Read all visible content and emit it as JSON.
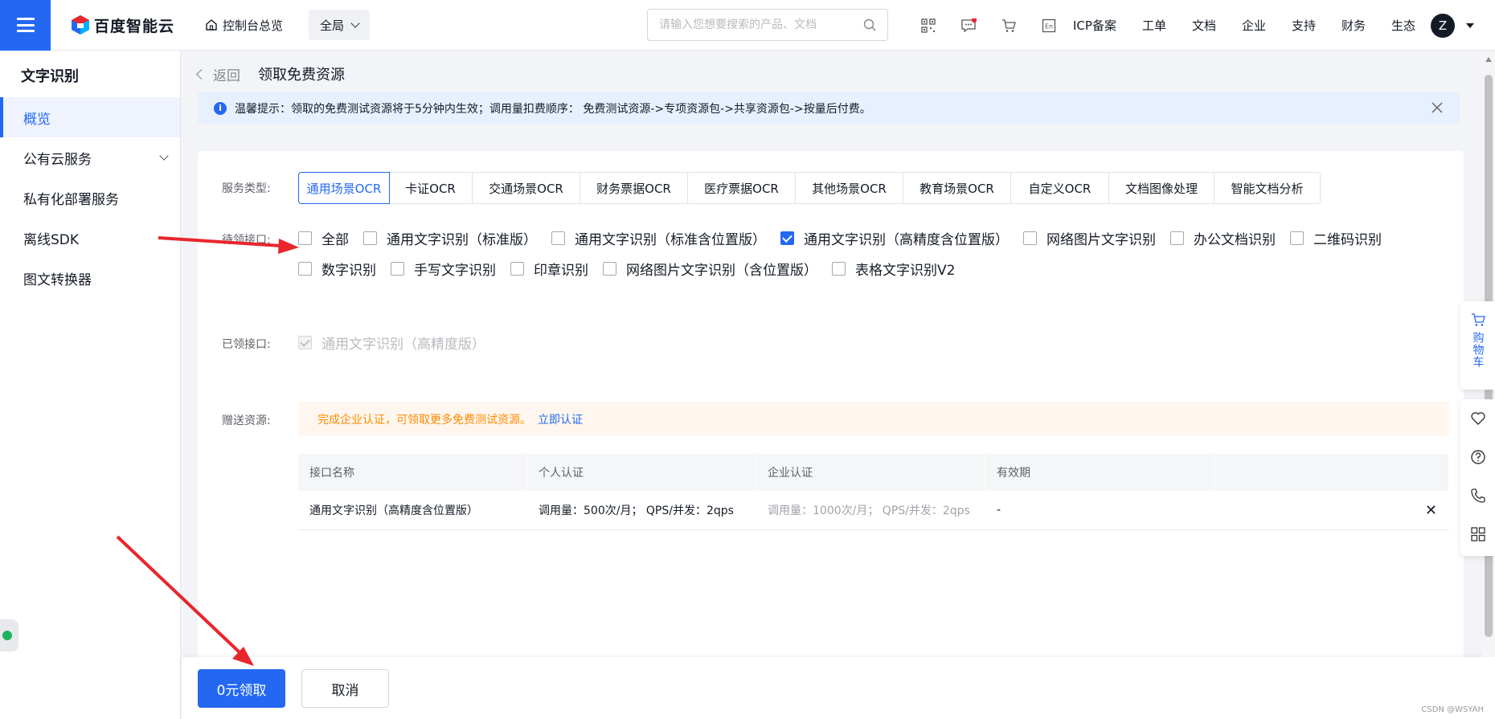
{
  "header": {
    "brand": "百度智能云",
    "home_label": "控制台总览",
    "region": "全局",
    "search_placeholder": "请输入您想要搜索的产品、文档",
    "links": [
      "ICP备案",
      "工单",
      "文档",
      "企业",
      "支持",
      "财务",
      "生态"
    ],
    "avatar_letter": "Z",
    "icons": [
      "qrcode-icon",
      "message-icon",
      "cart-icon",
      "language-icon"
    ]
  },
  "sidebar": {
    "title": "文字识别",
    "items": [
      {
        "label": "概览",
        "active": true
      },
      {
        "label": "公有云服务",
        "expandable": true
      },
      {
        "label": "私有化部署服务"
      },
      {
        "label": "离线SDK"
      },
      {
        "label": "图文转换器"
      }
    ]
  },
  "page": {
    "back_label": "返回",
    "title": "领取免费资源",
    "notice": "温馨提示：领取的免费测试资源将于5分钟内生效；调用量扣费顺序： 免费测试资源->专项资源包->共享资源包->按量后付费。"
  },
  "form": {
    "service_type_label": "服务类型:",
    "service_tabs": [
      "通用场景OCR",
      "卡证OCR",
      "交通场景OCR",
      "财务票据OCR",
      "医疗票据OCR",
      "其他场景OCR",
      "教育场景OCR",
      "自定义OCR",
      "文档图像处理",
      "智能文档分析"
    ],
    "pending_label": "待领接口:",
    "pending_row1": [
      {
        "label": "全部",
        "checked": false
      },
      {
        "label": "通用文字识别（标准版）",
        "checked": false
      },
      {
        "label": "通用文字识别（标准含位置版）",
        "checked": false
      },
      {
        "label": "通用文字识别（高精度含位置版）",
        "checked": true
      },
      {
        "label": "网络图片文字识别",
        "checked": false
      },
      {
        "label": "办公文档识别",
        "checked": false
      },
      {
        "label": "二维码识别",
        "checked": false
      }
    ],
    "pending_row2": [
      {
        "label": "数字识别",
        "checked": false
      },
      {
        "label": "手写文字识别",
        "checked": false
      },
      {
        "label": "印章识别",
        "checked": false
      },
      {
        "label": "网络图片文字识别（含位置版）",
        "checked": false
      },
      {
        "label": "表格文字识别V2",
        "checked": false
      }
    ],
    "claimed_label": "已领接口:",
    "claimed": "通用文字识别（高精度版）",
    "gift_label": "赠送资源:",
    "promo_text": "完成企业认证，可领取更多免费测试资源。",
    "promo_link": "立即认证",
    "table": {
      "headers": [
        "接口名称",
        "个人认证",
        "企业认证",
        "有效期"
      ],
      "rows": [
        [
          "通用文字识别（高精度含位置版）",
          "调用量：500次/月； QPS/并发：2qps",
          "调用量：1000次/月； QPS/并发：2qps",
          "-"
        ]
      ]
    }
  },
  "footer": {
    "primary": "0元领取",
    "cancel": "取消",
    "watermark": "CSDN @WSYAH"
  },
  "float_bar": {
    "cart_label": "购物车",
    "buttons": [
      "favorite-icon",
      "help-icon",
      "phone-icon",
      "apps-icon"
    ]
  },
  "colors": {
    "primary": "#2468f2",
    "annotation": "#e8262c",
    "promo": "#ff8a00"
  }
}
